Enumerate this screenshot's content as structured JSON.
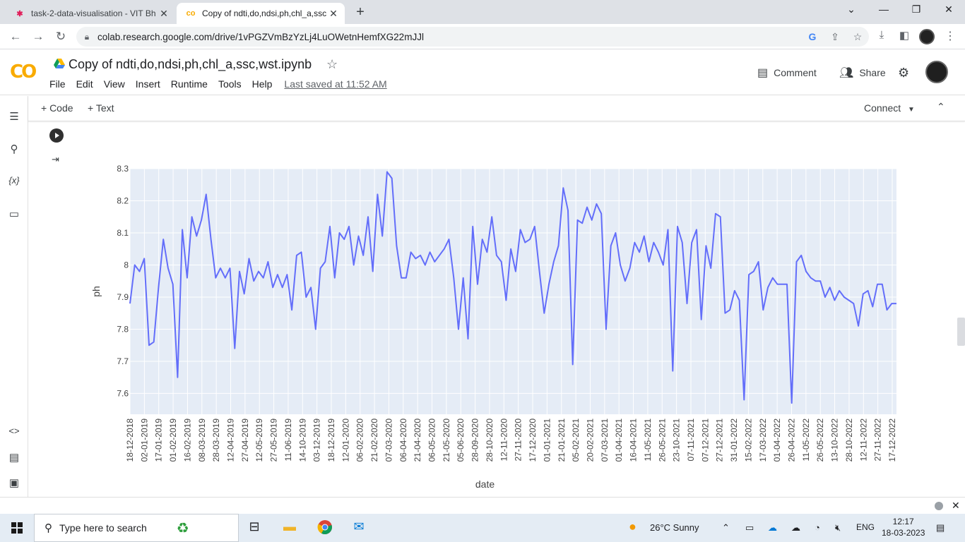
{
  "browser": {
    "tabs": [
      {
        "title": "task-2-data-visualisation - VIT Bh",
        "active": false,
        "icon": "slack-icon"
      },
      {
        "title": "Copy of ndti,do,ndsi,ph,chl_a,ssc",
        "active": true,
        "icon": "colab-icon"
      }
    ],
    "url": "colab.research.google.com/drive/1vPGZVmBzYzLj4LuOWetnHemfXG22mJJl"
  },
  "colab": {
    "logo": "CO",
    "notebook_title": "Copy of ndti,do,ndsi,ph,chl_a,ssc,wst.ipynb",
    "menu": [
      "File",
      "Edit",
      "View",
      "Insert",
      "Runtime",
      "Tools",
      "Help"
    ],
    "last_saved": "Last saved at 11:52 AM",
    "comment_label": "Comment",
    "share_label": "Share",
    "add_code_label": "+ Code",
    "add_text_label": "+ Text",
    "connect_label": "Connect"
  },
  "chart_data": {
    "type": "line",
    "xlabel": "date",
    "ylabel": "ph",
    "ylim": [
      7.535,
      8.3
    ],
    "yticks": [
      7.6,
      7.7,
      7.8,
      7.9,
      8,
      8.1,
      8.2,
      8.3
    ],
    "ytick_labels": [
      "7.6",
      "7.7",
      "7.8",
      "7.9",
      "8",
      "8.1",
      "8.2",
      "8.3"
    ],
    "xtick_labels": [
      "18-12-2018",
      "02-01-2019",
      "17-01-2019",
      "01-02-2019",
      "16-02-2019",
      "08-03-2019",
      "28-03-2019",
      "12-04-2019",
      "27-04-2019",
      "12-05-2019",
      "27-05-2019",
      "11-06-2019",
      "14-10-2019",
      "03-12-2019",
      "18-12-2019",
      "12-01-2020",
      "06-02-2020",
      "21-02-2020",
      "07-03-2020",
      "06-04-2020",
      "21-04-2020",
      "06-05-2020",
      "21-05-2020",
      "05-06-2020",
      "28-09-2020",
      "28-10-2020",
      "12-11-2020",
      "27-11-2020",
      "17-12-2020",
      "01-01-2021",
      "21-01-2021",
      "05-02-2021",
      "20-02-2021",
      "07-03-2021",
      "01-04-2021",
      "16-04-2021",
      "11-05-2021",
      "26-05-2021",
      "23-10-2021",
      "07-11-2021",
      "07-12-2021",
      "27-12-2021",
      "31-01-2022",
      "15-02-2022",
      "17-03-2022",
      "01-04-2022",
      "26-04-2022",
      "11-05-2022",
      "26-05-2022",
      "13-10-2022",
      "28-10-2022",
      "12-11-2022",
      "27-11-2022",
      "17-12-2022"
    ],
    "series": [
      {
        "color": "#636efa",
        "values": [
          7.88,
          8.0,
          7.98,
          8.02,
          7.75,
          7.76,
          7.93,
          8.08,
          7.99,
          7.94,
          7.65,
          8.11,
          7.96,
          8.15,
          8.09,
          8.14,
          8.22,
          8.08,
          7.96,
          7.99,
          7.96,
          7.99,
          7.74,
          7.98,
          7.91,
          8.02,
          7.95,
          7.98,
          7.96,
          8.01,
          7.93,
          7.97,
          7.93,
          7.97,
          7.86,
          8.03,
          8.04,
          7.9,
          7.93,
          7.8,
          7.99,
          8.01,
          8.12,
          7.96,
          8.1,
          8.08,
          8.12,
          8.0,
          8.09,
          8.03,
          8.15,
          7.98,
          8.22,
          8.09,
          8.29,
          8.27,
          8.06,
          7.96,
          7.96,
          8.04,
          8.02,
          8.03,
          8.0,
          8.04,
          8.01,
          8.03,
          8.05,
          8.08,
          7.96,
          7.8,
          7.96,
          7.77,
          8.12,
          7.94,
          8.08,
          8.04,
          8.15,
          8.03,
          8.01,
          7.89,
          8.05,
          7.98,
          8.11,
          8.07,
          8.08,
          8.12,
          7.98,
          7.85,
          7.94,
          8.01,
          8.06,
          8.24,
          8.17,
          7.69,
          8.14,
          8.13,
          8.18,
          8.14,
          8.19,
          8.16,
          7.8,
          8.06,
          8.1,
          8.0,
          7.95,
          7.99,
          8.07,
          8.04,
          8.09,
          8.01,
          8.07,
          8.04,
          8.0,
          8.11,
          7.67,
          8.12,
          8.07,
          7.88,
          8.07,
          8.11,
          7.83,
          8.06,
          7.99,
          8.16,
          8.15,
          7.85,
          7.86,
          7.92,
          7.89,
          7.58,
          7.97,
          7.98,
          8.01,
          7.86,
          7.93,
          7.96,
          7.94,
          7.94,
          7.94,
          7.57,
          8.01,
          8.03,
          7.98,
          7.96,
          7.95,
          7.95,
          7.9,
          7.93,
          7.89,
          7.92,
          7.9,
          7.89,
          7.88,
          7.81,
          7.91,
          7.92,
          7.87,
          7.94,
          7.94,
          7.86,
          7.88,
          7.88
        ]
      }
    ],
    "background": "#e5ecf6",
    "grid": true
  },
  "taskbar": {
    "search_placeholder": "Type here to search",
    "weather": "26°C  Sunny",
    "lang": "ENG",
    "time": "12:17",
    "date": "18-03-2023"
  }
}
